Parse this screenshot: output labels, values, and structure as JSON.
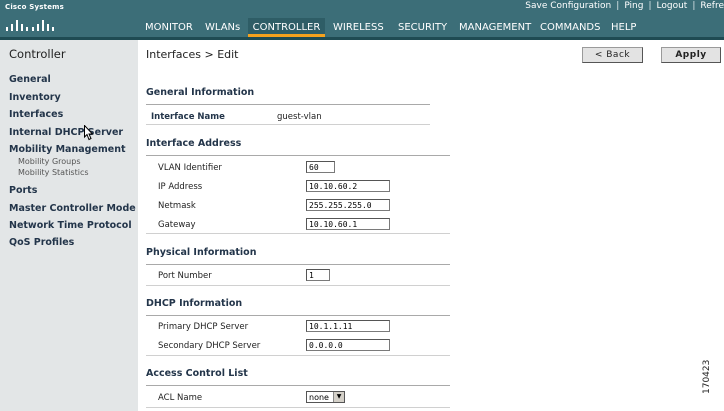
{
  "brand": {
    "logo_text": "Cisco Systems"
  },
  "top_links": [
    "Save Configuration",
    "Ping",
    "Logout",
    "Refre"
  ],
  "menu": [
    "MONITOR",
    "WLANs",
    "CONTROLLER",
    "WIRELESS",
    "SECURITY",
    "MANAGEMENT",
    "COMMANDS",
    "HELP"
  ],
  "menu_active": "CONTROLLER",
  "sidebar": {
    "title": "Controller",
    "items": [
      "General",
      "Inventory",
      "Interfaces",
      "Internal DHCP Server",
      "Mobility Management"
    ],
    "sub_items": [
      "Mobility Groups",
      "Mobility Statistics"
    ],
    "items2": [
      "Ports",
      "Master Controller Mode",
      "Network Time Protocol",
      "QoS Profiles"
    ]
  },
  "page": {
    "title": "Interfaces > Edit",
    "back_label": "< Back",
    "apply_label": "Apply"
  },
  "general": {
    "heading": "General Information",
    "interface_name_label": "Interface Name",
    "interface_name_value": "guest-vlan"
  },
  "address": {
    "heading": "Interface Address",
    "vlan_label": "VLAN Identifier",
    "vlan_value": "60",
    "ip_label": "IP Address",
    "ip_value": "10.10.60.2",
    "netmask_label": "Netmask",
    "netmask_value": "255.255.255.0",
    "gateway_label": "Gateway",
    "gateway_value": "10.10.60.1"
  },
  "physical": {
    "heading": "Physical Information",
    "port_label": "Port Number",
    "port_value": "1"
  },
  "dhcp": {
    "heading": "DHCP Information",
    "primary_label": "Primary DHCP Server",
    "primary_value": "10.1.1.11",
    "secondary_label": "Secondary DHCP Server",
    "secondary_value": "0.0.0.0"
  },
  "acl": {
    "heading": "Access Control List",
    "acl_label": "ACL Name",
    "acl_value": "none"
  },
  "figure_id": "170423",
  "colors": {
    "header": "#3c6e78",
    "active_tab_underline": "#f5a21e",
    "sidebar_bg": "#e3e6e7",
    "heading": "#23354a"
  }
}
